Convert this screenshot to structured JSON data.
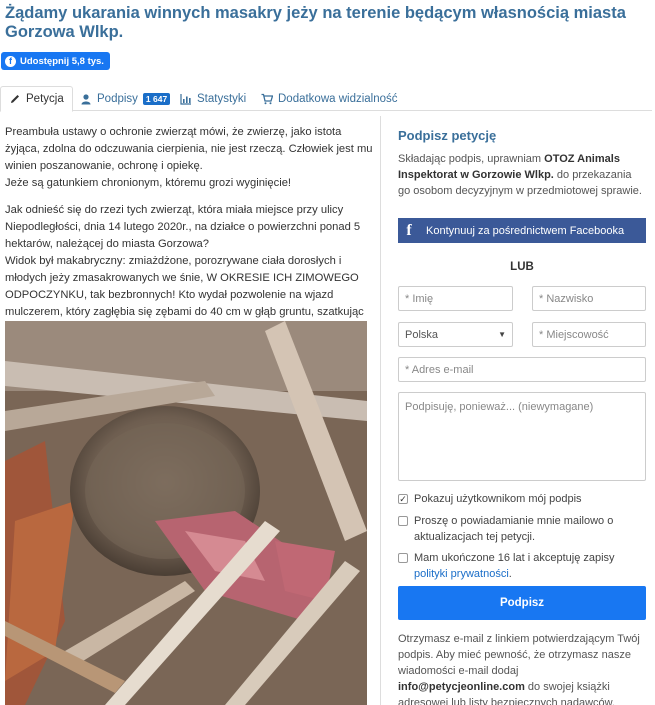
{
  "page": {
    "title": "Żądamy ukarania winnych masakry jeży na terenie będącym własnością miasta Gorzowa Wlkp."
  },
  "share": {
    "label": "Udostępnij 5,8 tys."
  },
  "tabs": [
    {
      "label": "Petycja",
      "icon": "pencil-icon",
      "active": true
    },
    {
      "label": "Podpisy",
      "icon": "user-icon",
      "badge": "1 647"
    },
    {
      "label": "Statystyki",
      "icon": "bar-chart-icon"
    },
    {
      "label": "Dodatkowa widzialność",
      "icon": "cart-icon"
    }
  ],
  "petition": {
    "p1": "Preambuła ustawy o ochronie zwierząt mówi, że zwierzę, jako istota żyjąca, zdolna do odczuwania cierpienia, nie jest rzeczą. Człowiek jest mu winien poszanowanie, ochronę i opiekę.",
    "p2": "Jeże są gatunkiem chronionym, któremu grozi wyginięcie!",
    "p3": "Jak odnieść się do rzezi tych zwierząt, która miała miejsce przy ulicy Niepodległości, dnia 14 lutego 2020r., na działce o powierzchni ponad 5 hektarów, należącej do miasta Gorzowa?",
    "p4": "Widok był makabryczny: zmiażdżone, porozrywane ciała dorosłych i młodych jeży zmasakrowanych we śnie, W OKRESIE ICH ZIMOWEGO ODPOCZYNKU,  tak bezbronnych! Kto wydał pozwolenie na wjazd mulczerem, który zagłębia się zębami do 40 cm w głąb gruntu, szatkując wszystko, co stanie na jego drodze, bez uprzedniego sprawdzenia terenu?"
  },
  "sign": {
    "title": "Podpisz petycję",
    "consent_pre": "Składając podpis, uprawniam ",
    "consent_org": "OTOZ Animals Inspektorat w Gorzowie Wlkp.",
    "consent_post": " do przekazania go osobom decyzyjnym w przedmiotowej sprawie.",
    "facebook_button": "Kontynuuj za pośrednictwem Facebooka",
    "or_label": "LUB",
    "first_name_placeholder": "* Imię",
    "last_name_placeholder": "* Nazwisko",
    "country_value": "Polska",
    "city_placeholder": "* Miejscowość",
    "email_placeholder": "* Adres e-mail",
    "comment_placeholder": "Podpisuję, ponieważ... (niewymagane)",
    "check_show_signature": "Pokazuj użytkownikom mój podpis",
    "check_show_signature_checked": true,
    "check_updates": "Proszę o powiadamianie mnie mailowo o aktualizacjach tej petycji.",
    "check_age_pre": "Mam ukończone 16 lat i akceptuję zapisy ",
    "check_age_link": "polityki prywatności",
    "check_age_post": ".",
    "submit_label": "Podpisz",
    "info_pre": "Otrzymasz e-mail z linkiem potwierdzającym Twój podpis. Aby mieć pewność, że otrzymasz nasze wiadomości e-mail dodaj ",
    "info_email": "info@petycjeonline.com",
    "info_post": " do swojej książki adresowej lub listy bezpiecznych nadawców."
  },
  "colors": {
    "accent": "#3a6f9a",
    "facebook": "#3b5998",
    "primary_button": "#1877f2",
    "badge": "#1a6ec8"
  }
}
